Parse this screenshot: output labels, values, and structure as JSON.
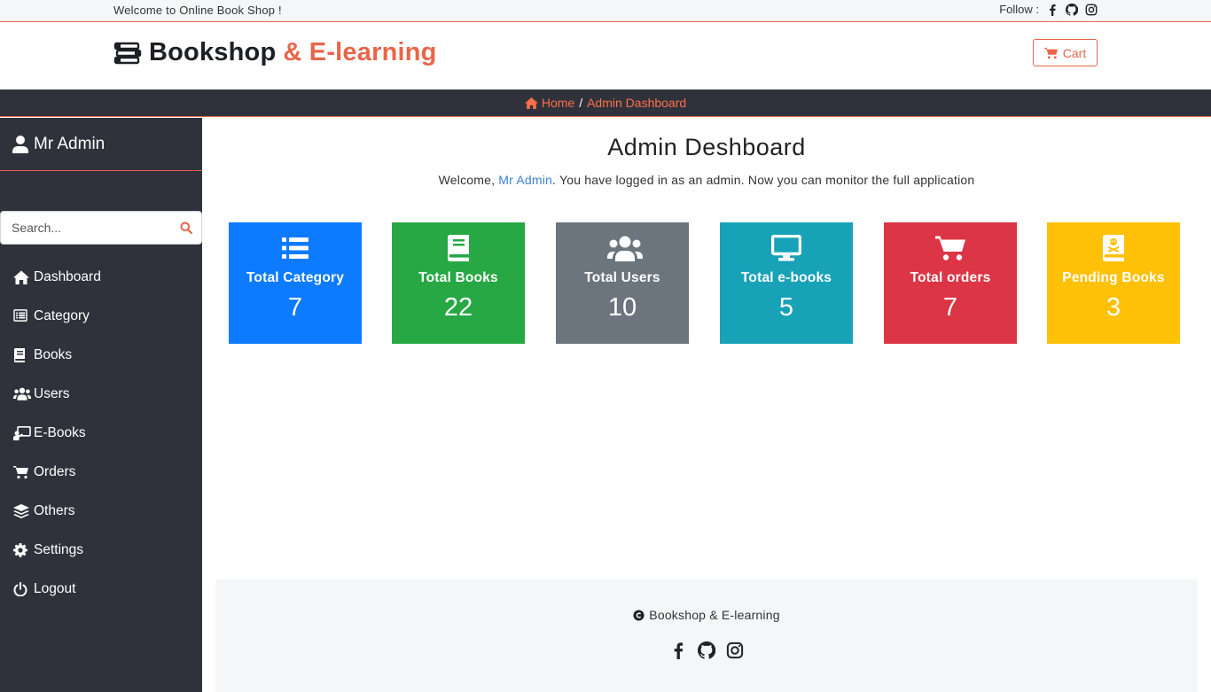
{
  "topbar": {
    "welcome": "Welcome to Online Book Shop !",
    "follow_label": "Follow :"
  },
  "header": {
    "brand_main": "Bookshop",
    "brand_accent": "& E-learning",
    "cart_label": "Cart"
  },
  "breadcrumb": {
    "home": "Home",
    "separator": "/",
    "current": "Admin Dashboard"
  },
  "sidebar": {
    "user_name": "Mr Admin",
    "search_placeholder": "Search...",
    "items": [
      {
        "label": "Dashboard",
        "icon": "home-icon"
      },
      {
        "label": "Category",
        "icon": "list-icon"
      },
      {
        "label": "Books",
        "icon": "book-icon"
      },
      {
        "label": "Users",
        "icon": "users-icon"
      },
      {
        "label": "E-Books",
        "icon": "chalkboard-icon"
      },
      {
        "label": "Orders",
        "icon": "cart-icon"
      },
      {
        "label": "Others",
        "icon": "layers-icon"
      },
      {
        "label": "Settings",
        "icon": "gear-icon"
      },
      {
        "label": "Logout",
        "icon": "power-icon"
      }
    ]
  },
  "main": {
    "title": "Admin Deshboard",
    "welcome_prefix": "Welcome, ",
    "welcome_name": "Mr Admin",
    "welcome_suffix": ". You have logged in as an admin. Now you can monitor the full application",
    "cards": [
      {
        "label": "Total Category",
        "count": "7",
        "color": "#0d7bff",
        "icon": "list-icon"
      },
      {
        "label": "Total Books",
        "count": "22",
        "color": "#28a745",
        "icon": "book-icon"
      },
      {
        "label": "Total Users",
        "count": "10",
        "color": "#6c757d",
        "icon": "users-icon"
      },
      {
        "label": "Total e-books",
        "count": "5",
        "color": "#17a2b8",
        "icon": "desktop-icon"
      },
      {
        "label": "Total orders",
        "count": "7",
        "color": "#dc3545",
        "icon": "cart-icon"
      },
      {
        "label": "Pending Books",
        "count": "3",
        "color": "#ffc107",
        "icon": "book-dead-icon"
      }
    ]
  },
  "footer": {
    "copyright": "Bookshop & E-learning"
  },
  "colors": {
    "accent": "#e8664a",
    "sidebar_bg": "#2f323a",
    "link": "#3b82d6"
  }
}
